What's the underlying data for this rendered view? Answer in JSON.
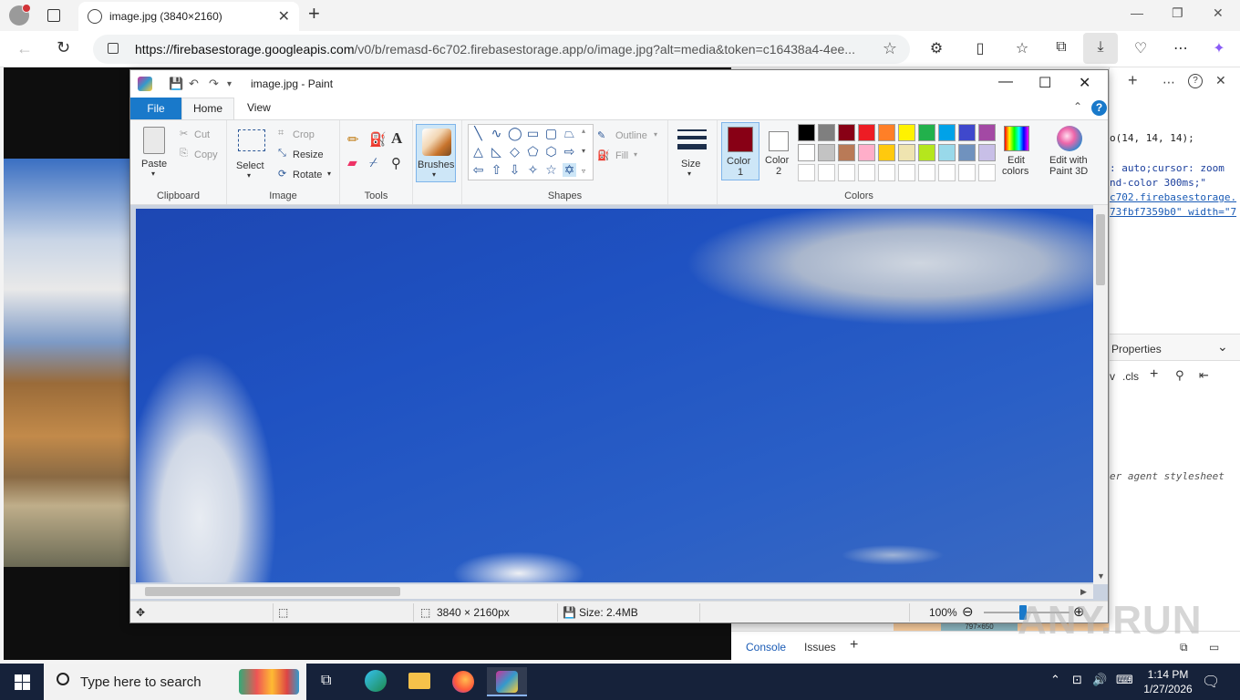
{
  "browser": {
    "tab_title": "image.jpg (3840×2160)",
    "url_host": "https://firebasestorage.googleapis.com",
    "url_path": "/v0/b/remasd-6c702.firebasestorage.app/o/image.jpg?alt=media&token=c16438a4-4ee..."
  },
  "devtools": {
    "code_lines": [
      "o(14, 14, 14);",
      ": auto;cursor: zoom",
      "nd-color 300ms;\"",
      "c702.firebasestorage.",
      "73fbf7359b0\" width=\"7"
    ],
    "properties_label": "Properties",
    "filter_label": "v",
    "cls_label": ".cls",
    "ua_label": "er agent stylesheet",
    "boxmodel_size": "797×650",
    "console_tab": "Console",
    "issues_tab": "Issues"
  },
  "paint": {
    "window_title": "image.jpg - Paint",
    "tabs": {
      "file": "File",
      "home": "Home",
      "view": "View"
    },
    "clipboard": {
      "paste": "Paste",
      "cut": "Cut",
      "copy": "Copy",
      "group": "Clipboard"
    },
    "image": {
      "select": "Select",
      "crop": "Crop",
      "resize": "Resize",
      "rotate": "Rotate",
      "group": "Image"
    },
    "tools": {
      "group": "Tools"
    },
    "brushes": "Brushes",
    "shapes": {
      "outline": "Outline",
      "fill": "Fill",
      "group": "Shapes"
    },
    "size": "Size",
    "colors": {
      "color1": "Color",
      "color1_num": "1",
      "color2": "Color",
      "color2_num": "2",
      "edit_colors_1": "Edit",
      "edit_colors_2": "colors",
      "paint3d_1": "Edit with",
      "paint3d_2": "Paint 3D",
      "group": "Colors",
      "color1_value": "#880015",
      "color2_value": "#ffffff",
      "palette_row1": [
        "#000000",
        "#7f7f7f",
        "#880015",
        "#ed1c24",
        "#ff7f27",
        "#fff200",
        "#22b14c",
        "#00a2e8",
        "#3f48cc",
        "#a349a4"
      ],
      "palette_row2": [
        "#ffffff",
        "#c3c3c3",
        "#b97a57",
        "#ffaec9",
        "#ffc90e",
        "#efe4b0",
        "#b5e61d",
        "#99d9ea",
        "#7092be",
        "#c8bfe7"
      ]
    },
    "status": {
      "dimensions": "3840 × 2160px",
      "size": "Size: 2.4MB",
      "zoom": "100%"
    }
  },
  "taskbar": {
    "search_placeholder": "Type here to search",
    "time": "1:14 PM",
    "date": "1/27/2026"
  },
  "watermark": "ANY.RUN"
}
